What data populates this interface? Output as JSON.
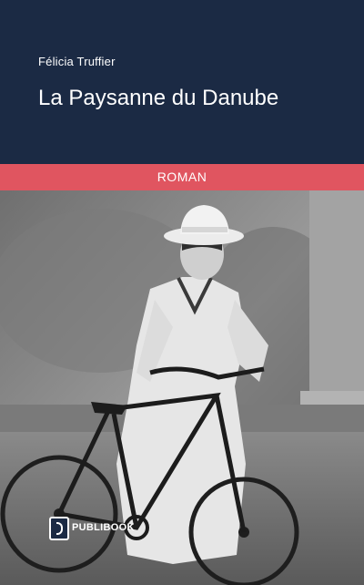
{
  "cover": {
    "author": "Félicia Truffier",
    "title": "La Paysanne du Danube",
    "genre": "ROMAN",
    "publisher": "PUBLIBOOK"
  },
  "colors": {
    "header_bg": "#1b2a44",
    "band_bg": "#e05560",
    "text": "#ffffff"
  }
}
